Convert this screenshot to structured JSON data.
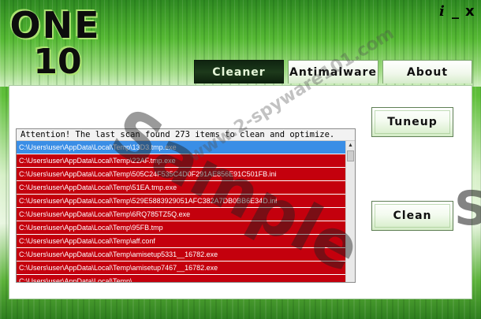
{
  "app": {
    "logo_top": "ONE",
    "logo_bottom": "10"
  },
  "window_controls": {
    "info": "i",
    "minimize": "_",
    "close": "x"
  },
  "tabs": [
    {
      "label": "Cleaner",
      "active": true
    },
    {
      "label": "Antimalware",
      "active": false
    },
    {
      "label": "About",
      "active": false
    }
  ],
  "scan": {
    "message": "Attention! The last scan found 273 items to clean and optimize.",
    "items": [
      "C:\\Users\\user\\AppData\\Local\\Temp\\13D3.tmp.exe",
      "C:\\Users\\user\\AppData\\Local\\Temp\\22AF.tmp.exe",
      "C:\\Users\\user\\AppData\\Local\\Temp\\505C24F535C4D0F291AE856E91C501FB.ini",
      "C:\\Users\\user\\AppData\\Local\\Temp\\51EA.tmp.exe",
      "C:\\Users\\user\\AppData\\Local\\Temp\\529E5883929051AFC382A7DB0BB6E34D.ini",
      "C:\\Users\\user\\AppData\\Local\\Temp\\6RQ785TZ5Q.exe",
      "C:\\Users\\user\\AppData\\Local\\Temp\\95FB.tmp",
      "C:\\Users\\user\\AppData\\Local\\Temp\\aff.conf",
      "C:\\Users\\user\\AppData\\Local\\Temp\\amisetup5331__16782.exe",
      "C:\\Users\\user\\AppData\\Local\\Temp\\amisetup7467__16782.exe",
      "C:\\Users\\user\\AppData\\Local\\Temp\\..."
    ],
    "selected_index": 0
  },
  "buttons": {
    "tuneup": "Tuneup",
    "clean": "Clean"
  },
  "watermark": {
    "main": "Sample",
    "site": "www.2-spyware101.com",
    "edge": "S"
  },
  "colors": {
    "row_flagged": "#c4000d",
    "row_selected": "#3a8ee6",
    "active_tab": "#1d3a1b"
  }
}
